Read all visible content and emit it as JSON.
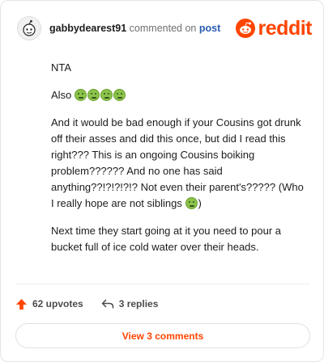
{
  "header": {
    "username": "gabbydearest91",
    "action_text": "commented on",
    "post_link": "post",
    "brand": "reddit"
  },
  "comment": {
    "paragraphs": [
      "NTA",
      "Also",
      "And it would be bad enough if your Cousins got drunk off their asses and did this once, but did I read this right??? This is an ongoing Cousins boiking problem?????? And no one has said anything??!?!?!?!? Not even their parent's?????",
      "(Who I really hope are not siblings",
      ")",
      "Next time they start going at it you need to pour a bucket full of ice cold water over their heads."
    ],
    "emoji": "sick-face-emoji"
  },
  "footer": {
    "upvotes": "62 upvotes",
    "replies": "3 replies",
    "view_button": "View 3 comments"
  },
  "colors": {
    "brand": "#ff4500",
    "link": "#2a5db0",
    "emoji": "#8bc34a"
  }
}
